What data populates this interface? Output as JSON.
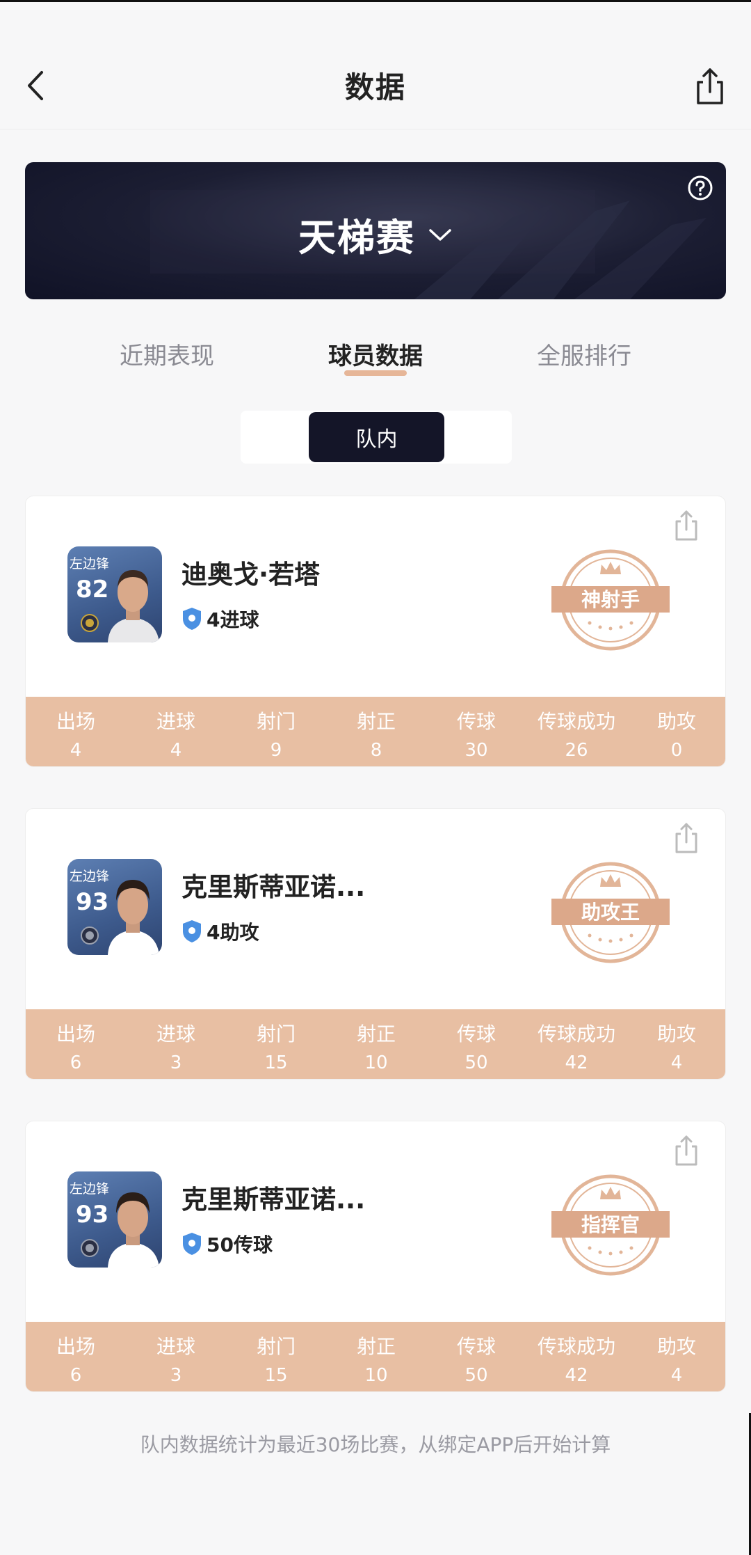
{
  "header": {
    "title": "数据",
    "back_icon": "chevron-left-icon",
    "share_icon": "share-icon"
  },
  "banner": {
    "mode": "天梯赛",
    "dropdown_icon": "chevron-down-icon",
    "help_icon": "question-circle-icon"
  },
  "tabs": [
    {
      "label": "近期表现",
      "active": false
    },
    {
      "label": "球员数据",
      "active": true
    },
    {
      "label": "全服排行",
      "active": false
    }
  ],
  "segment": {
    "selected": "队内"
  },
  "stat_labels": [
    "出场",
    "进球",
    "射门",
    "射正",
    "传球",
    "传球成功",
    "助攻"
  ],
  "players": [
    {
      "position": "左边锋",
      "rating": "82",
      "name": "迪奥戈·若塔",
      "badge": "4进球",
      "stamp": "神射手",
      "stats": [
        "4",
        "4",
        "9",
        "8",
        "30",
        "26",
        "0"
      ],
      "medal_color": "#c9a53a"
    },
    {
      "position": "左边锋",
      "rating": "93",
      "name": "克里斯蒂亚诺...",
      "badge": "4助攻",
      "stamp": "助攻王",
      "stats": [
        "6",
        "3",
        "15",
        "10",
        "50",
        "42",
        "4"
      ],
      "medal_color": "#3a3a3a"
    },
    {
      "position": "左边锋",
      "rating": "93",
      "name": "克里斯蒂亚诺...",
      "badge": "50传球",
      "stamp": "指挥官",
      "stats": [
        "6",
        "3",
        "15",
        "10",
        "50",
        "42",
        "4"
      ],
      "medal_color": "#3a3a3a"
    }
  ],
  "footnote": "队内数据统计为最近30场比赛，从绑定APP后开始计算",
  "colors": {
    "accent": "#e8bfa3",
    "stamp": "#dca88a",
    "dark": "#141528",
    "badge_blue": "#4a90e2"
  }
}
